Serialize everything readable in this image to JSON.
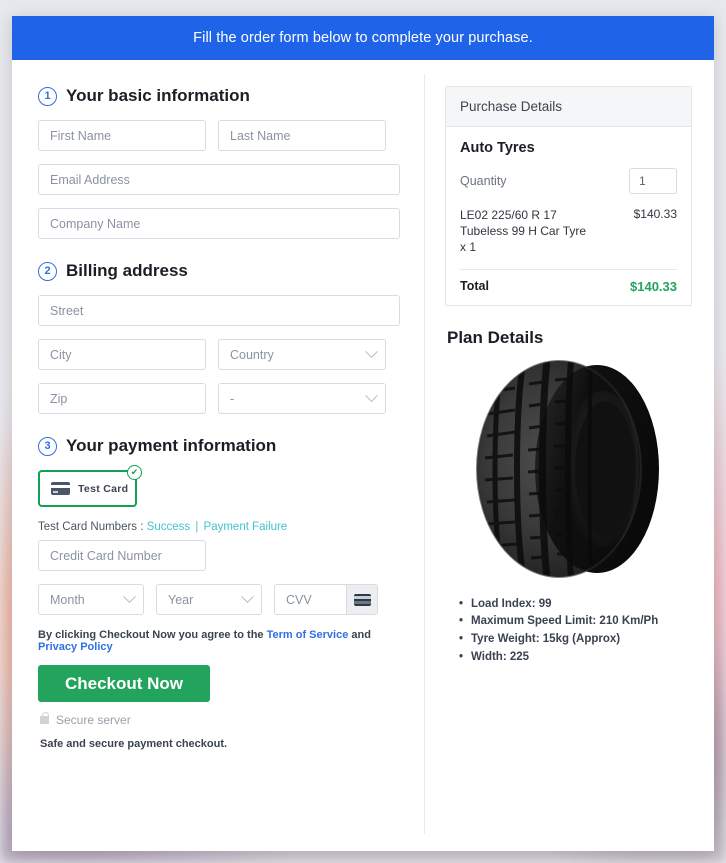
{
  "banner": {
    "text": "Fill the order form below to complete your purchase."
  },
  "steps": {
    "basic": {
      "number": "1",
      "title": "Your basic information",
      "fields": {
        "first_name": "First Name",
        "last_name": "Last Name",
        "email": "Email Address",
        "company": "Company Name"
      }
    },
    "billing": {
      "number": "2",
      "title": "Billing address",
      "fields": {
        "street": "Street",
        "city": "City",
        "country": "Country",
        "zip": "Zip",
        "state": "-"
      }
    },
    "payment": {
      "number": "3",
      "title": "Your payment information",
      "card_chip": {
        "label": "Test Card",
        "icon": "credit-card-icon",
        "check_icon": "✔",
        "selected": true
      },
      "test_numbers": {
        "prefix": "Test Card Numbers :",
        "success_link": "Success",
        "separator": "|",
        "failure_link": "Payment Failure"
      },
      "fields": {
        "card_number": "Credit Card Number",
        "month": "Month",
        "year": "Year",
        "cvv": "CVV"
      },
      "cvv_icon": "card-back-icon"
    }
  },
  "footer": {
    "agree_prefix": "By clicking Checkout Now you agree to the",
    "terms_link": "Term of Service",
    "agree_mid": "and",
    "privacy_link": "Privacy Policy",
    "checkout_label": "Checkout Now",
    "secure_icon": "lock-icon",
    "secure_text": "Secure server",
    "safe_text": "Safe and secure payment checkout."
  },
  "purchase": {
    "header": "Purchase Details",
    "product_title": "Auto Tyres",
    "quantity_label": "Quantity",
    "quantity_value": "1",
    "item_name": "LE02 225/60 R 17 Tubeless 99 H Car Tyre x 1",
    "item_price": "$140.33",
    "total_label": "Total",
    "total_value": "$140.33"
  },
  "plan": {
    "title": "Plan Details",
    "image_name": "car-tyre-photo",
    "specs": [
      "Load Index: 99",
      "Maximum Speed Limit: 210 Km/Ph",
      "Tyre Weight: 15kg (Approx)",
      "Width: 225"
    ]
  },
  "colors": {
    "banner_blue": "#1f63e8",
    "accent_blue": "#2f6fe4",
    "success_green": "#22a45d",
    "chip_green": "#12a150",
    "link_teal": "#45c2d1"
  }
}
